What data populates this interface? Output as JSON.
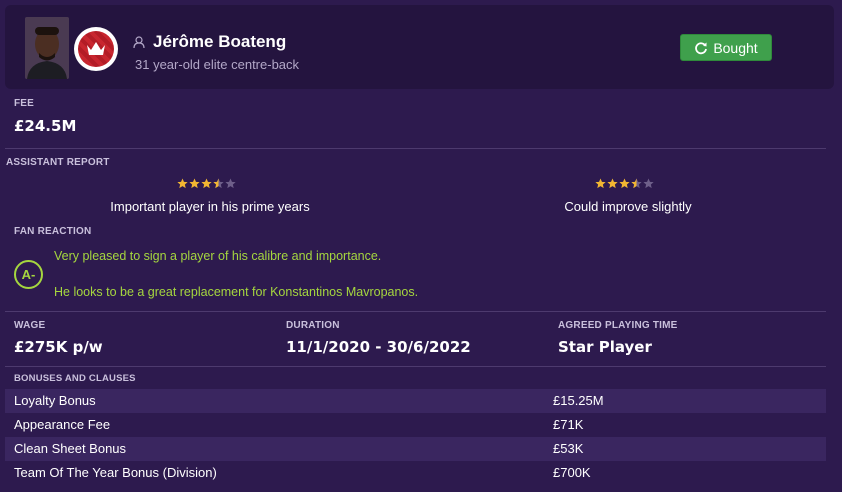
{
  "player": {
    "name": "Jérôme Boateng",
    "subtitle": "31 year-old elite centre-back",
    "status_button": "Bought"
  },
  "fee": {
    "label": "FEE",
    "value": "£24.5M"
  },
  "assistant_report": {
    "label": "ASSISTANT REPORT",
    "items": [
      {
        "rating_stars": 3.5,
        "max_stars": 5,
        "text": "Important player in his prime years"
      },
      {
        "rating_stars": 3.5,
        "max_stars": 5,
        "text": "Could improve slightly"
      }
    ]
  },
  "fan_reaction": {
    "label": "FAN REACTION",
    "grade": "A-",
    "lines": [
      "Very pleased to sign a player of his calibre and importance.",
      "He looks to be a great replacement for Konstantinos Mavropanos."
    ]
  },
  "contract": {
    "wage_label": "WAGE",
    "wage_value": "£275K p/w",
    "duration_label": "DURATION",
    "duration_value": "11/1/2020 - 30/6/2022",
    "playing_time_label": "AGREED PLAYING TIME",
    "playing_time_value": "Star Player"
  },
  "bonuses": {
    "label": "BONUSES AND CLAUSES",
    "rows": [
      {
        "name": "Loyalty Bonus",
        "value": "£15.25M"
      },
      {
        "name": "Appearance Fee",
        "value": "£71K"
      },
      {
        "name": "Clean Sheet Bonus",
        "value": "£53K"
      },
      {
        "name": "Team Of The Year Bonus (Division)",
        "value": "£700K"
      }
    ]
  },
  "colors": {
    "background": "#2d1a4e",
    "header": "#24143f",
    "button_green": "#3fa04c",
    "star_gold": "#f2b632",
    "star_empty": "#6e5f8a",
    "grade_green": "#a5d63f"
  },
  "icons": {
    "status_button": "refresh-icon",
    "player_marker": "person-icon",
    "club": "club-crest-icon"
  }
}
